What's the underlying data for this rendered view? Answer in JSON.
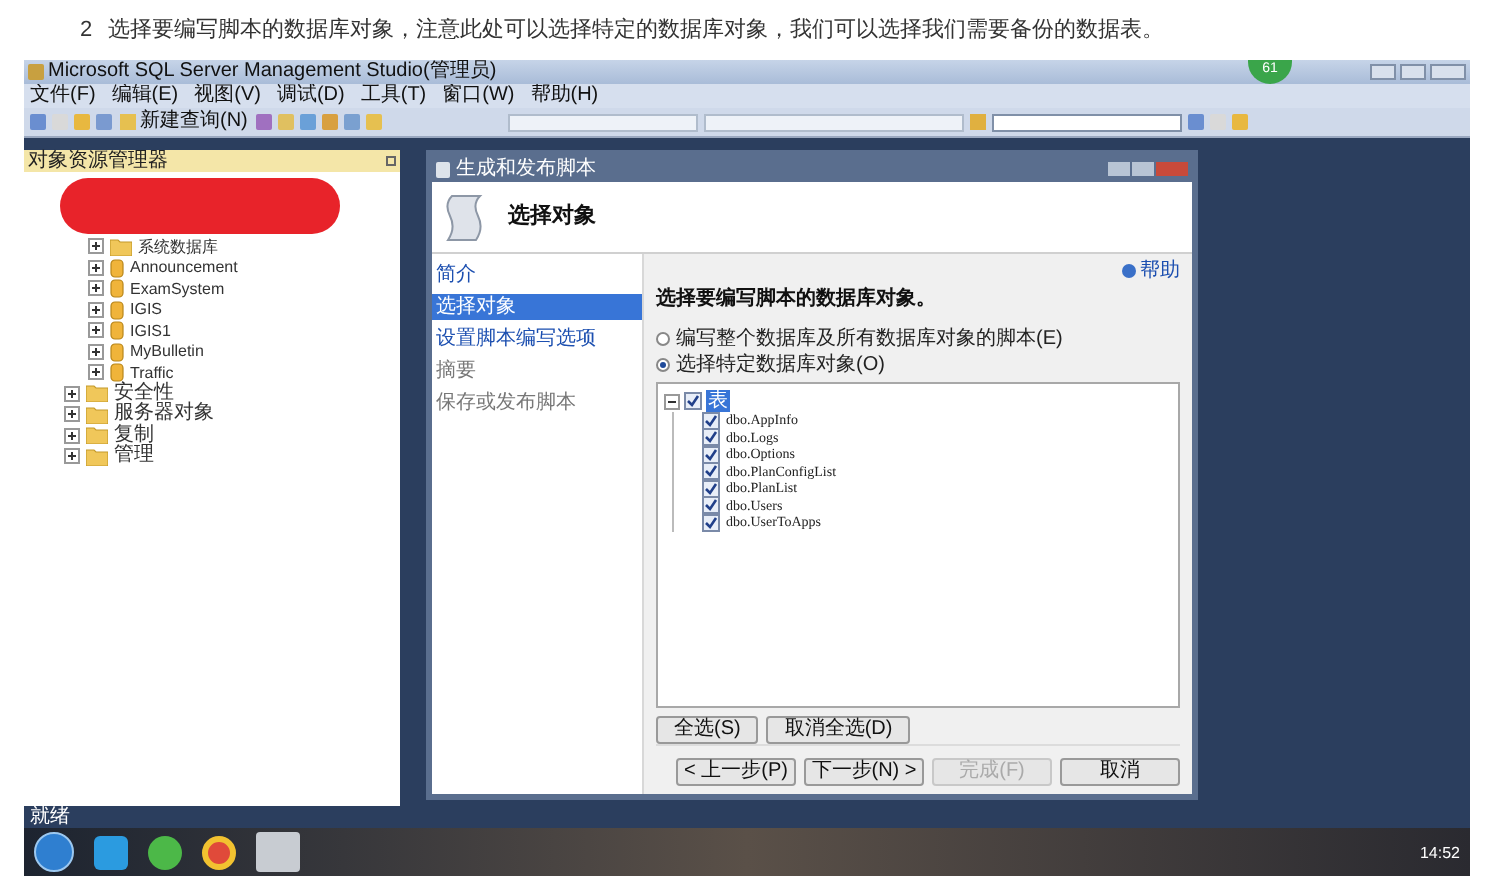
{
  "caption": {
    "number": "2",
    "text": "选择要编写脚本的数据库对象，注意此处可以选择特定的数据库对象，我们可以选择我们需要备份的数据表。"
  },
  "app": {
    "title": "Microsoft SQL Server Management Studio(管理员)",
    "badge": "61"
  },
  "menu": [
    "文件(F)",
    "编辑(E)",
    "视图(V)",
    "调试(D)",
    "工具(T)",
    "窗口(W)",
    "帮助(H)"
  ],
  "toolbar": {
    "new_query": "新建查询(N)"
  },
  "explorer": {
    "title": "对象资源管理器",
    "tree": [
      {
        "label": "系统数据库",
        "kind": "folder"
      },
      {
        "label": "Announcement",
        "kind": "database"
      },
      {
        "label": "ExamSystem",
        "kind": "database"
      },
      {
        "label": "IGIS",
        "kind": "database"
      },
      {
        "label": "IGIS1",
        "kind": "database"
      },
      {
        "label": "MyBulletin",
        "kind": "database"
      },
      {
        "label": "Traffic",
        "kind": "database"
      }
    ],
    "folders": [
      "安全性",
      "服务器对象",
      "复制",
      "管理"
    ]
  },
  "dialog": {
    "title": "生成和发布脚本",
    "header": "选择对象",
    "nav": [
      {
        "label": "简介",
        "selected": false,
        "disabled": false
      },
      {
        "label": "选择对象",
        "selected": true,
        "disabled": false
      },
      {
        "label": "设置脚本编写选项",
        "selected": false,
        "disabled": false
      },
      {
        "label": "摘要",
        "selected": false,
        "disabled": true
      },
      {
        "label": "保存或发布脚本",
        "selected": false,
        "disabled": true
      }
    ],
    "help": "帮助",
    "heading": "选择要编写脚本的数据库对象。",
    "options": [
      {
        "label": "编写整个数据库及所有数据库对象的脚本(E)",
        "selected": false
      },
      {
        "label": "选择特定数据库对象(O)",
        "selected": true
      }
    ],
    "tree": {
      "label": "表",
      "checked": true,
      "expanded": true,
      "children": [
        {
          "label": "dbo.AppInfo",
          "checked": true
        },
        {
          "label": "dbo.Logs",
          "checked": true
        },
        {
          "label": "dbo.Options",
          "checked": true
        },
        {
          "label": "dbo.PlanConfigList",
          "checked": true
        },
        {
          "label": "dbo.PlanList",
          "checked": true
        },
        {
          "label": "dbo.Users",
          "checked": true
        },
        {
          "label": "dbo.UserToApps",
          "checked": true
        }
      ]
    },
    "select_buttons": [
      "全选(S)",
      "取消全选(D)"
    ],
    "footer": [
      {
        "label": "< 上一步(P)",
        "disabled": false
      },
      {
        "label": "下一步(N) >",
        "disabled": false
      },
      {
        "label": "完成(F)",
        "disabled": true
      },
      {
        "label": "取消",
        "disabled": false
      }
    ]
  },
  "status_bar": "就绪",
  "taskbar": {
    "clock": "14:52"
  }
}
